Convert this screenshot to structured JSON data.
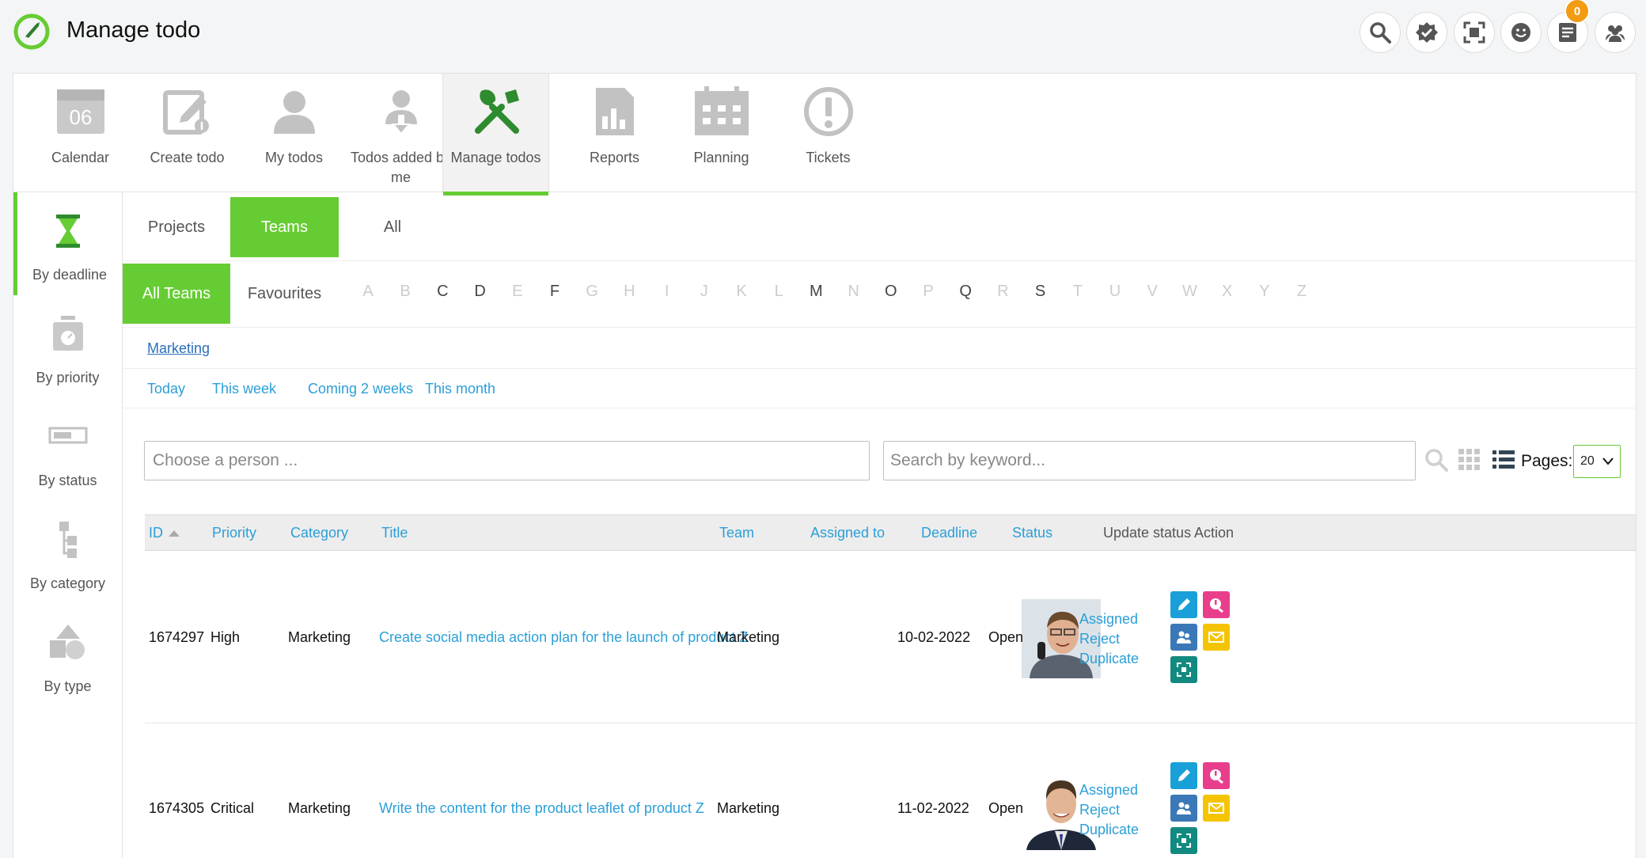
{
  "app": {
    "title": "Manage todo",
    "notification_count": "0"
  },
  "header_icons": [
    "search-icon",
    "checkmark-badge-icon",
    "focus-icon",
    "smiley-icon",
    "notes-icon",
    "users-icon"
  ],
  "modules": [
    {
      "label": "Calendar",
      "calendar_day": "06",
      "icon": "calendar-icon"
    },
    {
      "label": "Create todo",
      "icon": "create-todo-icon"
    },
    {
      "label": "My todos",
      "icon": "person-icon"
    },
    {
      "label": "Todos added by me",
      "icon": "person-download-icon"
    },
    {
      "label": "Manage todos",
      "icon": "tools-icon",
      "active": true
    },
    {
      "label": "Reports",
      "icon": "report-icon"
    },
    {
      "label": "Planning",
      "icon": "planning-icon"
    },
    {
      "label": "Tickets",
      "icon": "ticket-icon"
    }
  ],
  "sidebar": [
    {
      "label": "By deadline",
      "icon": "hourglass-icon",
      "active": true
    },
    {
      "label": "By priority",
      "icon": "scale-icon"
    },
    {
      "label": "By status",
      "icon": "status-bar-icon"
    },
    {
      "label": "By category",
      "icon": "tree-icon"
    },
    {
      "label": "By type",
      "icon": "shapes-icon"
    }
  ],
  "tabs": {
    "projects": "Projects",
    "teams": "Teams",
    "all": "All"
  },
  "filters": {
    "all_teams": "All Teams",
    "favourites": "Favourites"
  },
  "letters": [
    {
      "l": "A",
      "on": false
    },
    {
      "l": "B",
      "on": false
    },
    {
      "l": "C",
      "on": true
    },
    {
      "l": "D",
      "on": true
    },
    {
      "l": "E",
      "on": false
    },
    {
      "l": "F",
      "on": true
    },
    {
      "l": "G",
      "on": false
    },
    {
      "l": "H",
      "on": false
    },
    {
      "l": "I",
      "on": false
    },
    {
      "l": "J",
      "on": false
    },
    {
      "l": "K",
      "on": false
    },
    {
      "l": "L",
      "on": false
    },
    {
      "l": "M",
      "on": true
    },
    {
      "l": "N",
      "on": false
    },
    {
      "l": "O",
      "on": true
    },
    {
      "l": "P",
      "on": false
    },
    {
      "l": "Q",
      "on": true
    },
    {
      "l": "R",
      "on": false
    },
    {
      "l": "S",
      "on": true
    },
    {
      "l": "T",
      "on": false
    },
    {
      "l": "U",
      "on": false
    },
    {
      "l": "V",
      "on": false
    },
    {
      "l": "W",
      "on": false
    },
    {
      "l": "X",
      "on": false
    },
    {
      "l": "Y",
      "on": false
    },
    {
      "l": "Z",
      "on": false
    }
  ],
  "team_link": "Marketing",
  "periods": [
    "Today",
    "This week",
    "Coming 2 weeks",
    "This month"
  ],
  "search": {
    "person_placeholder": "Choose a person ...",
    "keyword_placeholder": "Search by keyword...",
    "pages_label": "Pages:",
    "pages_value": "20"
  },
  "table": {
    "headers": {
      "id": "ID",
      "priority": "Priority",
      "category": "Category",
      "title": "Title",
      "team": "Team",
      "assigned": "Assigned to",
      "deadline": "Deadline",
      "status": "Status",
      "update": "Update status",
      "action": "Action"
    },
    "rows": [
      {
        "id": "1674297",
        "priority": "High",
        "category": "Marketing",
        "title": "Create social media action plan for the launch of product Z",
        "team": "Marketing",
        "deadline": "10-02-2022",
        "status": "Open",
        "updates": [
          "Assigned",
          "Reject",
          "Duplicate"
        ]
      },
      {
        "id": "1674305",
        "priority": "Critical",
        "category": "Marketing",
        "title": "Write the content for the product leaflet of product Z",
        "team": "Marketing",
        "deadline": "11-02-2022",
        "status": "Open",
        "updates": [
          "Assigned",
          "Reject",
          "Duplicate"
        ]
      }
    ]
  },
  "colors": {
    "accent": "#66cc33",
    "link": "#2b9fd8",
    "badge": "#f39c12"
  }
}
